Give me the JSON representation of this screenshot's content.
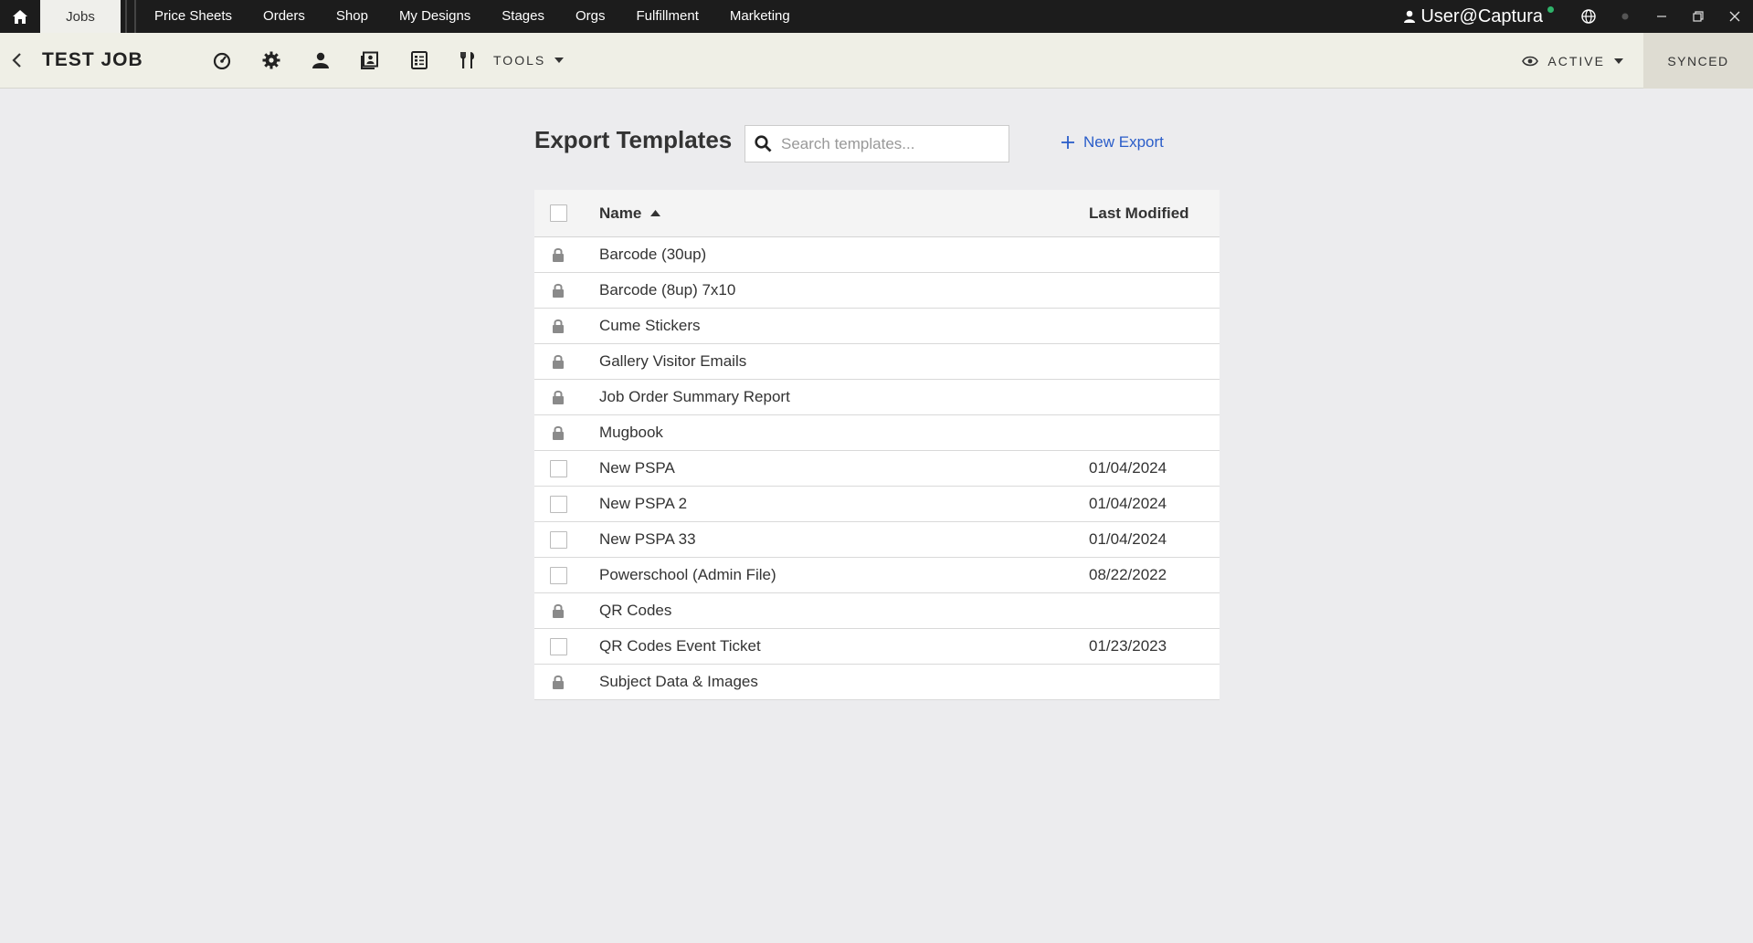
{
  "topnav": {
    "active_tab": "Jobs",
    "items": [
      "Price Sheets",
      "Orders",
      "Shop",
      "My Designs",
      "Stages",
      "Orgs",
      "Fulfillment",
      "Marketing"
    ],
    "user": "User@Captura"
  },
  "subbar": {
    "job_title": "TEST JOB",
    "tools_label": "TOOLS",
    "status_label": "ACTIVE",
    "sync_label": "SYNCED"
  },
  "main": {
    "title": "Export Templates",
    "search_placeholder": "Search templates...",
    "new_export_label": "New Export",
    "table": {
      "col_name": "Name",
      "col_modified": "Last Modified",
      "rows": [
        {
          "name": "Barcode (30up)",
          "modified": "",
          "locked": true
        },
        {
          "name": "Barcode (8up) 7x10",
          "modified": "",
          "locked": true
        },
        {
          "name": "Cume Stickers",
          "modified": "",
          "locked": true
        },
        {
          "name": "Gallery Visitor Emails",
          "modified": "",
          "locked": true
        },
        {
          "name": "Job Order Summary Report",
          "modified": "",
          "locked": true
        },
        {
          "name": "Mugbook",
          "modified": "",
          "locked": true
        },
        {
          "name": "New PSPA",
          "modified": "01/04/2024",
          "locked": false
        },
        {
          "name": "New PSPA 2",
          "modified": "01/04/2024",
          "locked": false
        },
        {
          "name": "New PSPA 33",
          "modified": "01/04/2024",
          "locked": false
        },
        {
          "name": "Powerschool (Admin File)",
          "modified": "08/22/2022",
          "locked": false
        },
        {
          "name": "QR Codes",
          "modified": "",
          "locked": true
        },
        {
          "name": "QR Codes Event Ticket",
          "modified": "01/23/2023",
          "locked": false
        },
        {
          "name": "Subject Data & Images",
          "modified": "",
          "locked": true
        }
      ]
    }
  },
  "colors": {
    "topnav_bg": "#1c1c1c",
    "subbar_bg": "#efefe6",
    "page_bg": "#ececee",
    "link": "#2a5dc9",
    "status_dot": "#2fb36a"
  }
}
